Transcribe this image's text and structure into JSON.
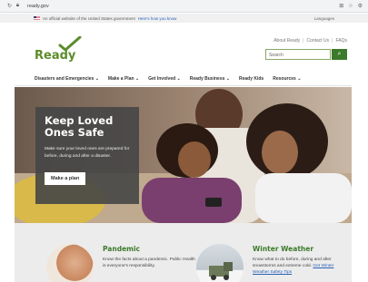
{
  "browser": {
    "url": "ready.gov",
    "icons": [
      "reload-icon",
      "lock-icon",
      "extensions-icon",
      "star-icon",
      "menu-icon"
    ]
  },
  "gov_banner": {
    "text": "An official website of the United States government",
    "link": "Here's how you know",
    "languages": "Languages"
  },
  "header": {
    "logo_text": "Ready",
    "utility_links": [
      "About Ready",
      "Contact Us",
      "FAQs"
    ],
    "search_placeholder": "Search"
  },
  "nav": {
    "items": [
      "Disasters and Emergencies",
      "Make a Plan",
      "Get Involved",
      "Ready Business",
      "Ready Kids",
      "Resources"
    ]
  },
  "hero": {
    "title": "Keep Loved Ones Safe",
    "body": "Make sure your loved ones are prepared for before, during and after a disaster.",
    "button": "Make a plan"
  },
  "features": [
    {
      "title": "Pandemic",
      "body": "Know the facts about a pandemic. Public Health is everyone's responsibility."
    },
    {
      "title": "Winter Weather",
      "body": "Know what to do before, during and after snowstorms and extreme cold.",
      "link": "Get Winter Weather Safety Tips"
    }
  ],
  "colors": {
    "brand_green": "#3c7a2b",
    "logo_green": "#5b8c2a",
    "card_bg": "#464646"
  }
}
